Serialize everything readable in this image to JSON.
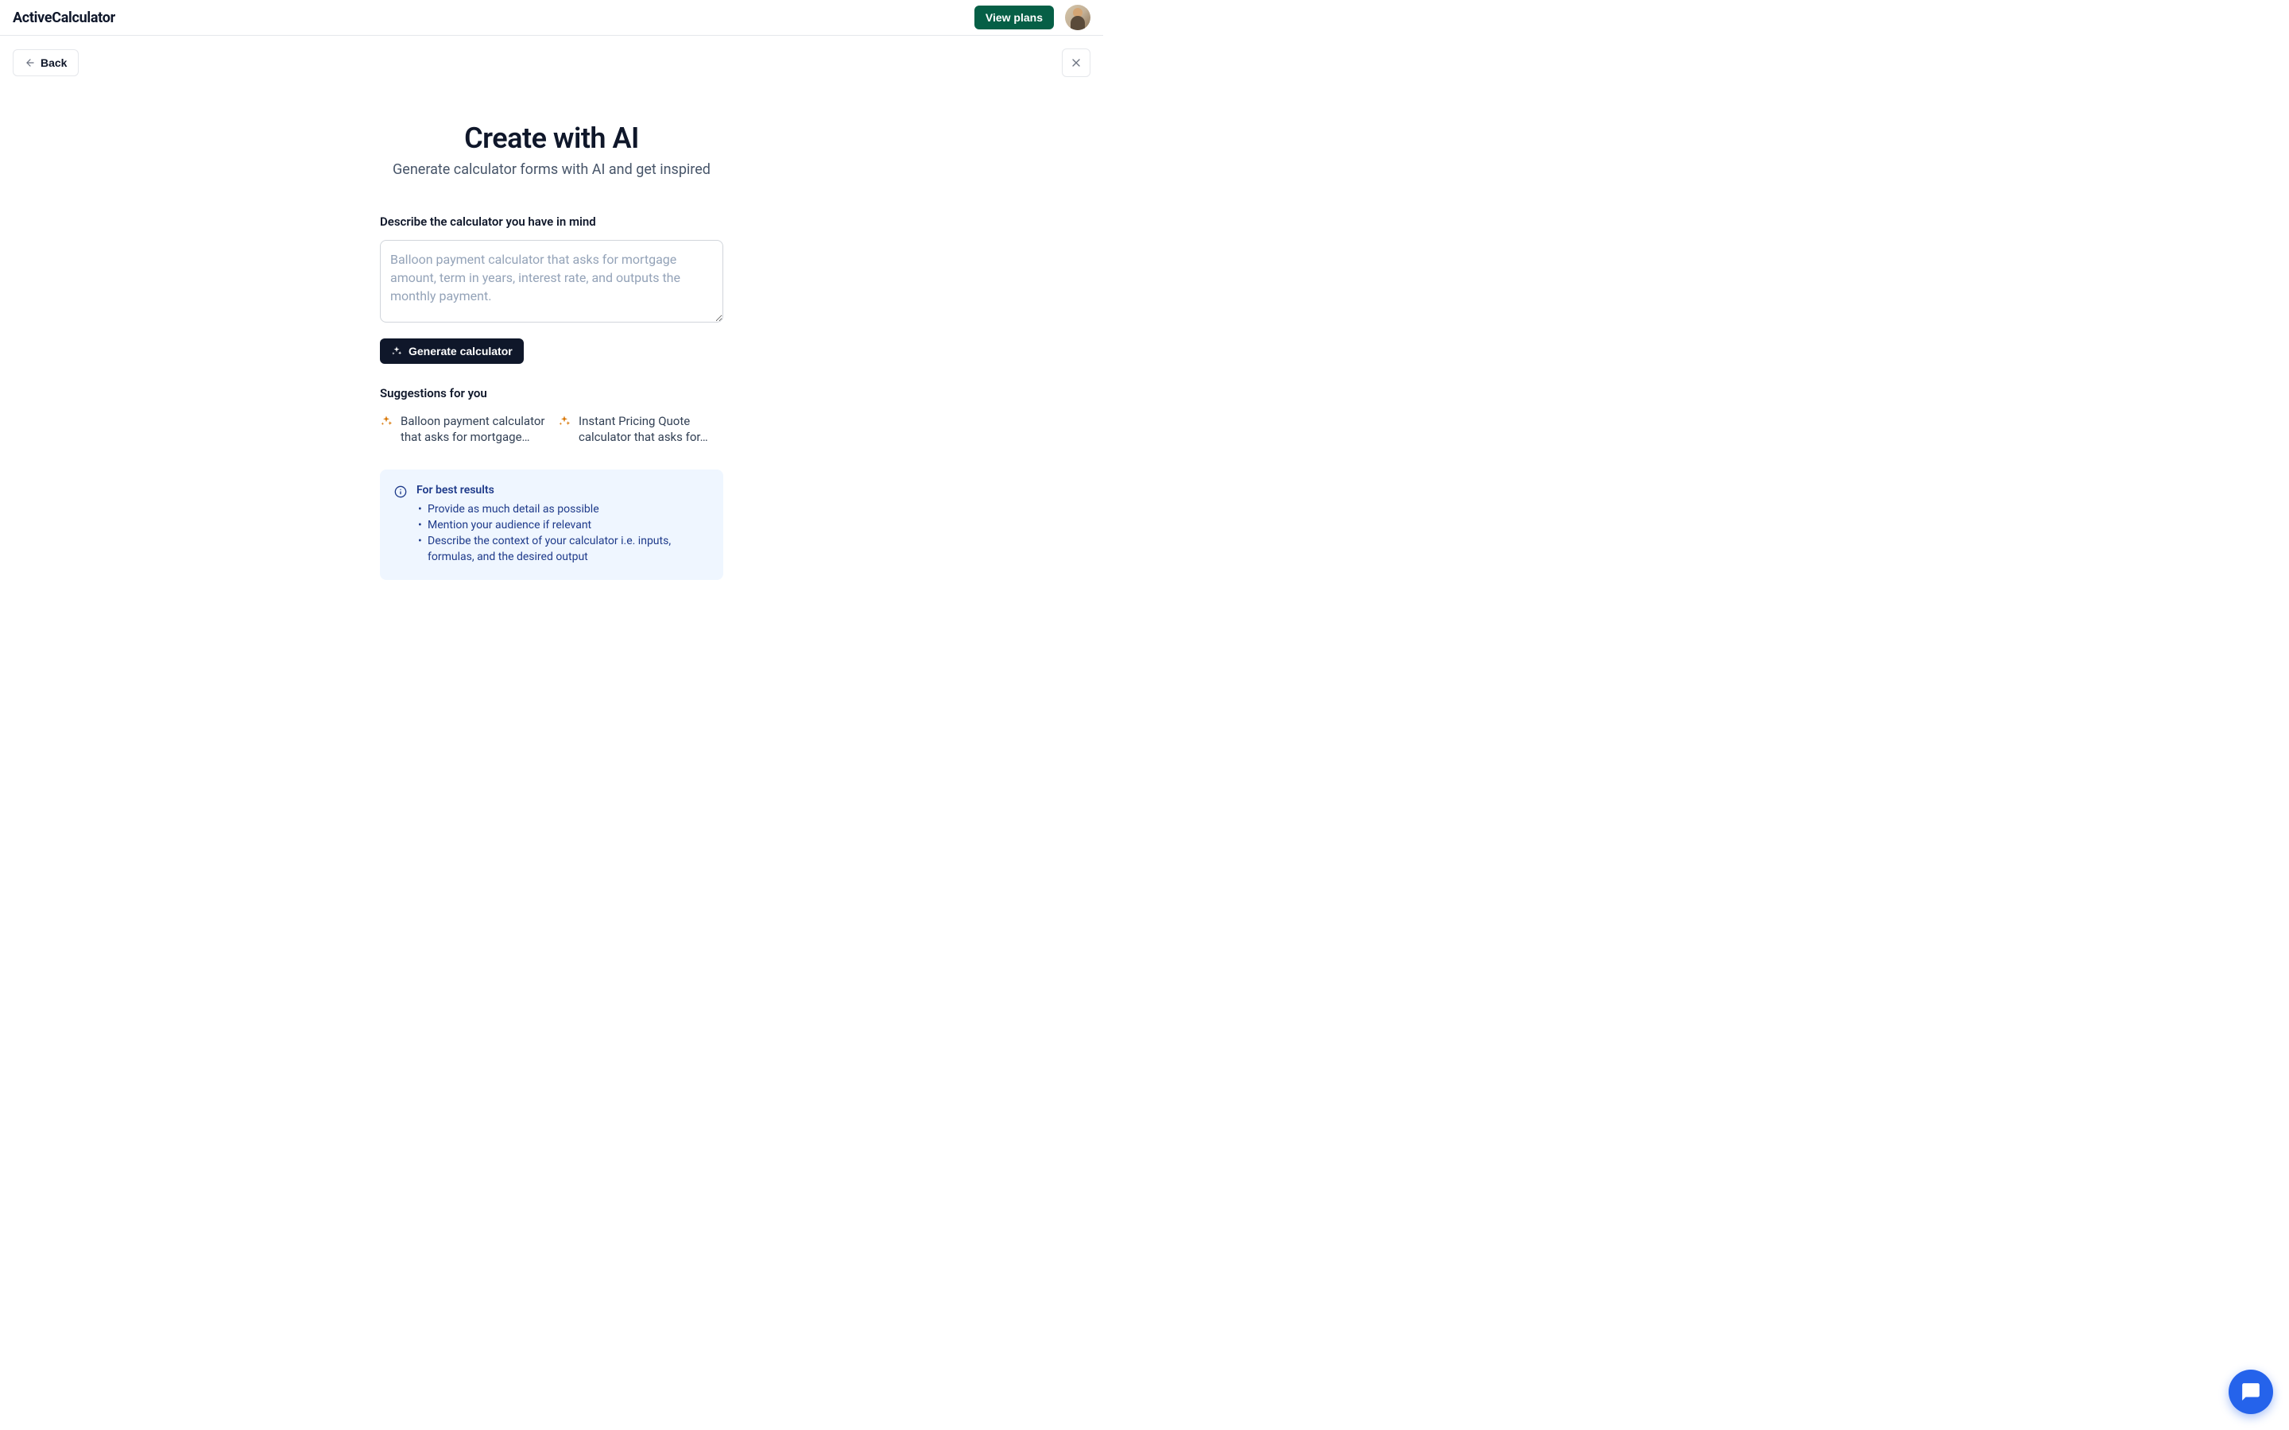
{
  "header": {
    "logo": "ActiveCalculator",
    "view_plans_label": "View plans"
  },
  "nav": {
    "back_label": "Back"
  },
  "main": {
    "title": "Create with AI",
    "subtitle": "Generate calculator forms with AI and get inspired",
    "form_label": "Describe the calculator you have in mind",
    "textarea_placeholder": "Balloon payment calculator that asks for mortgage amount, term in years, interest rate, and outputs the monthly payment.",
    "textarea_value": "",
    "generate_label": "Generate calculator",
    "suggestions_title": "Suggestions for you",
    "suggestions": [
      "Balloon payment calculator that asks for mortgage…",
      "Instant Pricing Quote calculator that asks for…"
    ],
    "tips": {
      "title": "For best results",
      "items": [
        "Provide as much detail as possible",
        "Mention your audience if relevant",
        "Describe the context of your calculator i.e. inputs, formulas, and the desired output"
      ]
    }
  },
  "colors": {
    "primary_green": "#065f46",
    "primary_dark": "#0f172a",
    "tip_bg": "#eff6ff",
    "tip_text": "#1e3a8a",
    "chat_blue": "#2563eb",
    "sparkle": "#d97706"
  }
}
